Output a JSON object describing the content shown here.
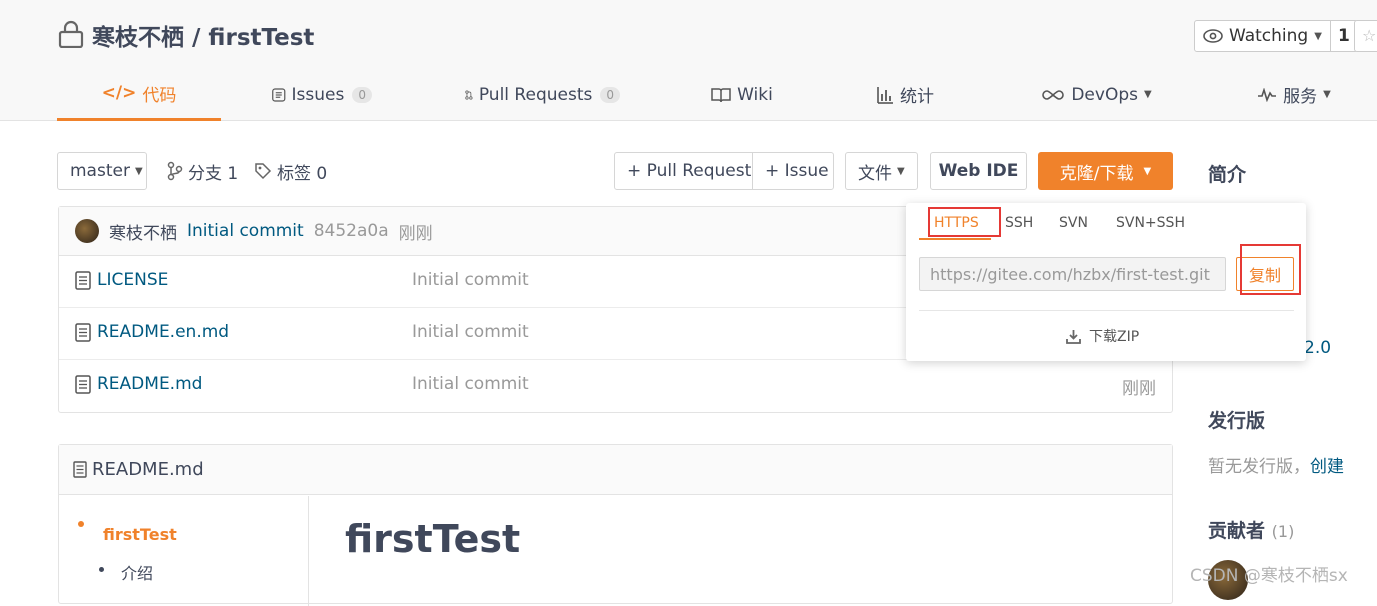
{
  "repo": {
    "owner": "寒枝不栖",
    "separator": " / ",
    "name": "firstTest"
  },
  "watch": {
    "label": "Watching",
    "count": "1"
  },
  "tabs": [
    {
      "label": "代码",
      "icon": "code-icon"
    },
    {
      "label": "Issues",
      "count": "0",
      "icon": "issues-icon"
    },
    {
      "label": "Pull Requests",
      "count": "0",
      "icon": "pull-request-icon"
    },
    {
      "label": "Wiki",
      "icon": "wiki-icon"
    },
    {
      "label": "统计",
      "icon": "stats-icon"
    },
    {
      "label": "DevOps",
      "icon": "devops-icon"
    },
    {
      "label": "服务",
      "icon": "service-icon"
    }
  ],
  "toolbar": {
    "branch": "master",
    "branches": "分支 1",
    "tags": "标签 0",
    "pull_request": "+ Pull Request",
    "issue": "+ Issue",
    "file": "文件",
    "web_ide": "Web IDE",
    "clone": "克隆/下载"
  },
  "commit": {
    "author": "寒枝不栖",
    "message": "Initial commit",
    "hash": "8452a0a",
    "time": "刚刚"
  },
  "files": [
    {
      "name": "LICENSE",
      "message": "Initial commit",
      "time": ""
    },
    {
      "name": "README.en.md",
      "message": "Initial commit",
      "time": ""
    },
    {
      "name": "README.md",
      "message": "Initial commit",
      "time": "刚刚"
    }
  ],
  "readme": {
    "title": "README.md",
    "toc": [
      "firstTest",
      "介绍"
    ],
    "heading": "firstTest"
  },
  "sidebar": {
    "intro": "简介",
    "license_fragment": "2.0",
    "releases": "发行版",
    "no_release": "暂无发行版，",
    "create": "创建",
    "contributors": "贡献者",
    "contributors_count": "(1)"
  },
  "clone_dropdown": {
    "tabs": [
      "HTTPS",
      "SSH",
      "SVN",
      "SVN+SSH"
    ],
    "url": "https://gitee.com/hzbx/first-test.git",
    "copy": "复制",
    "download": "下载ZIP"
  },
  "watermark": "CSDN @寒枝不栖sx",
  "colors": {
    "accent": "#f0822b",
    "link": "#005980",
    "highlight": "#e53935"
  }
}
